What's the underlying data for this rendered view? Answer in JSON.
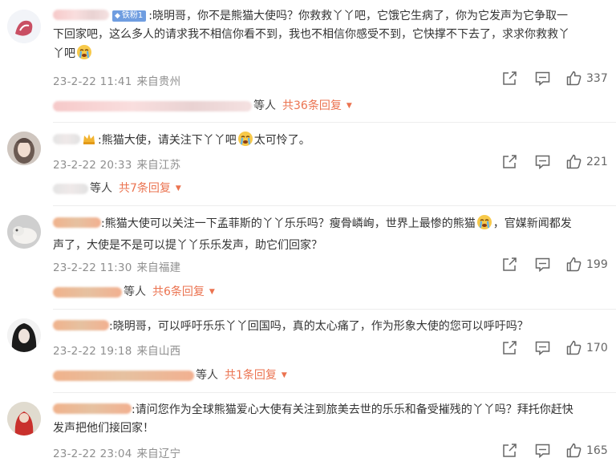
{
  "comments": [
    {
      "badge": "铁粉1",
      "text1": ":晓明哥，你不是熊猫大使吗？你救救丫丫吧，它饿它生病了，你为它发声为它争取一",
      "text2": "下回家吧，这么多人的请求我不相信你看不到，我也不相信你感受不到，它快撑不下去了，求求你救救丫",
      "text3": "丫吧",
      "time": "23-2-22 11:41",
      "location": "来自贵州",
      "likes": "337",
      "reply_users": "等人",
      "reply_more": "共36条回复"
    },
    {
      "text1a": ":熊猫大使，请关注下丫丫吧",
      "text1b": "太可怜了。",
      "time": "23-2-22 20:33",
      "location": "来自江苏",
      "likes": "221",
      "reply_users": "等人",
      "reply_more": "共7条回复"
    },
    {
      "text1a": ":熊猫大使可以关注一下孟菲斯的丫丫乐乐吗？瘦骨嶙峋，世界上最惨的熊猫",
      "text1b": "，官媒新闻都发",
      "text2": "声了，大使是不是可以提丫丫乐乐发声，助它们回家？",
      "time": "23-2-22 11:30",
      "location": "来自福建",
      "likes": "199",
      "reply_users": "等人",
      "reply_more": "共6条回复"
    },
    {
      "text1": ":晓明哥，可以呼吁乐乐丫丫回国吗，真的太心痛了，作为形象大使的您可以呼吁吗？",
      "time": "23-2-22 19:18",
      "location": "来自山西",
      "likes": "170",
      "reply_users": "等人",
      "reply_more": "共1条回复"
    },
    {
      "text1": ":请问您作为全球熊猫爱心大使有关注到旅美去世的乐乐和备受摧残的丫丫吗？拜托你赶快",
      "text2": "发声把他们接回家！",
      "time": "23-2-22 23:04",
      "location": "来自辽宁",
      "likes": "165"
    }
  ]
}
